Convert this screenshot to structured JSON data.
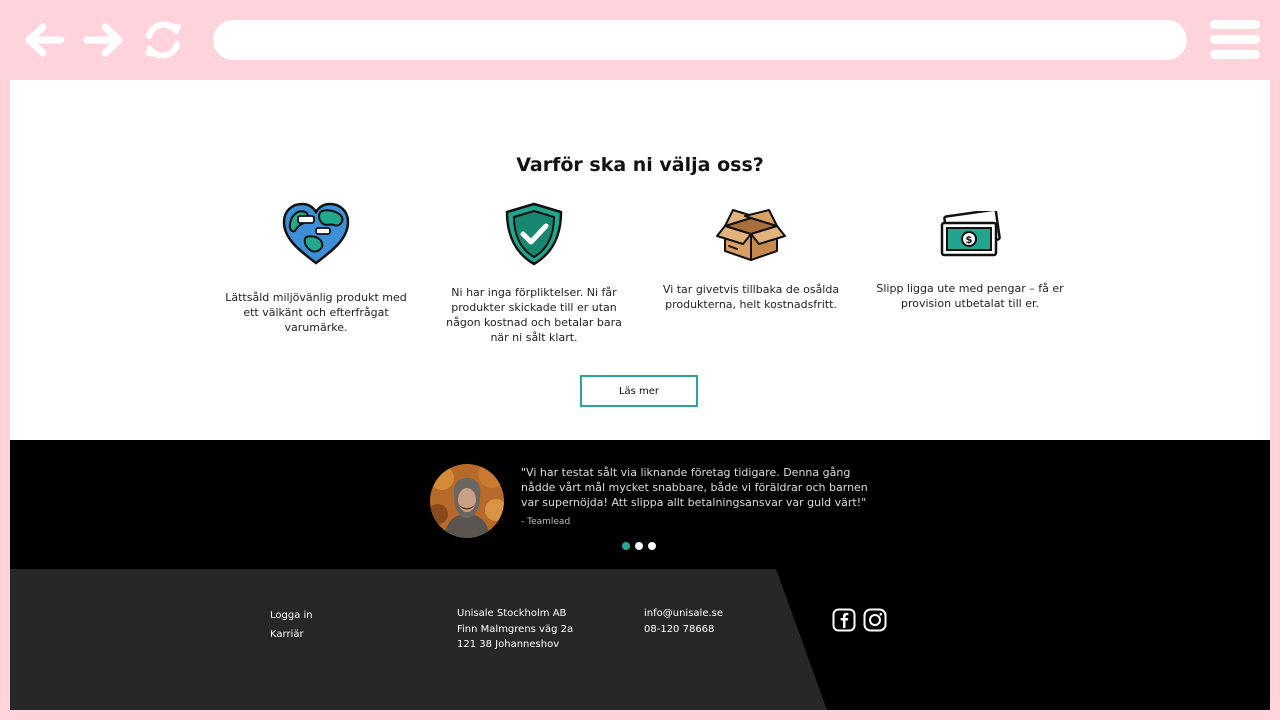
{
  "browser": {
    "url": "",
    "icons": [
      "back-arrow-icon",
      "forward-arrow-icon",
      "reload-icon",
      "hamburger-menu-icon"
    ]
  },
  "why": {
    "title": "Varför ska ni välja oss?",
    "features": [
      {
        "icon": "earth-heart-icon",
        "text": "Lättsåld miljövänlig produkt med ett välkänt och efterfrågat varumärke."
      },
      {
        "icon": "shield-check-icon",
        "text": "Ni har inga förpliktelser. Ni får produkter skickade till er utan någon kostnad och betalar bara när ni sålt klart."
      },
      {
        "icon": "cardboard-box-icon",
        "text": "Vi tar givetvis tillbaka de osålda produkterna, helt kostnadsfritt."
      },
      {
        "icon": "money-bill-icon",
        "text": "Slipp ligga ute med pengar – få er provision utbetalat till er."
      }
    ],
    "button_label": "Läs mer"
  },
  "testimonial": {
    "quote": "\"Vi har testat sålt via liknande företag tidigare. Denna gång nådde vårt mål mycket snabbare, både vi föräldrar och barnen var supernöjda! Att slippa allt betalningsansvar var guld värt!\"",
    "author": "- Teamlead",
    "slides": 3,
    "active_slide": 1
  },
  "footer": {
    "links": [
      "Logga in",
      "Karriär"
    ],
    "company": [
      "Unisale Stockholm AB",
      "Finn Malmgrens väg 2a",
      "121 38 Johanneshov"
    ],
    "contact": [
      "info@unisale.se",
      "08-120 78668"
    ],
    "social_icons": [
      "facebook-icon",
      "instagram-icon"
    ]
  },
  "colors": {
    "chrome": "#ffd3dc",
    "accent": "#2aa59a",
    "footer_left": "#272727",
    "footer_right": "#000000"
  }
}
